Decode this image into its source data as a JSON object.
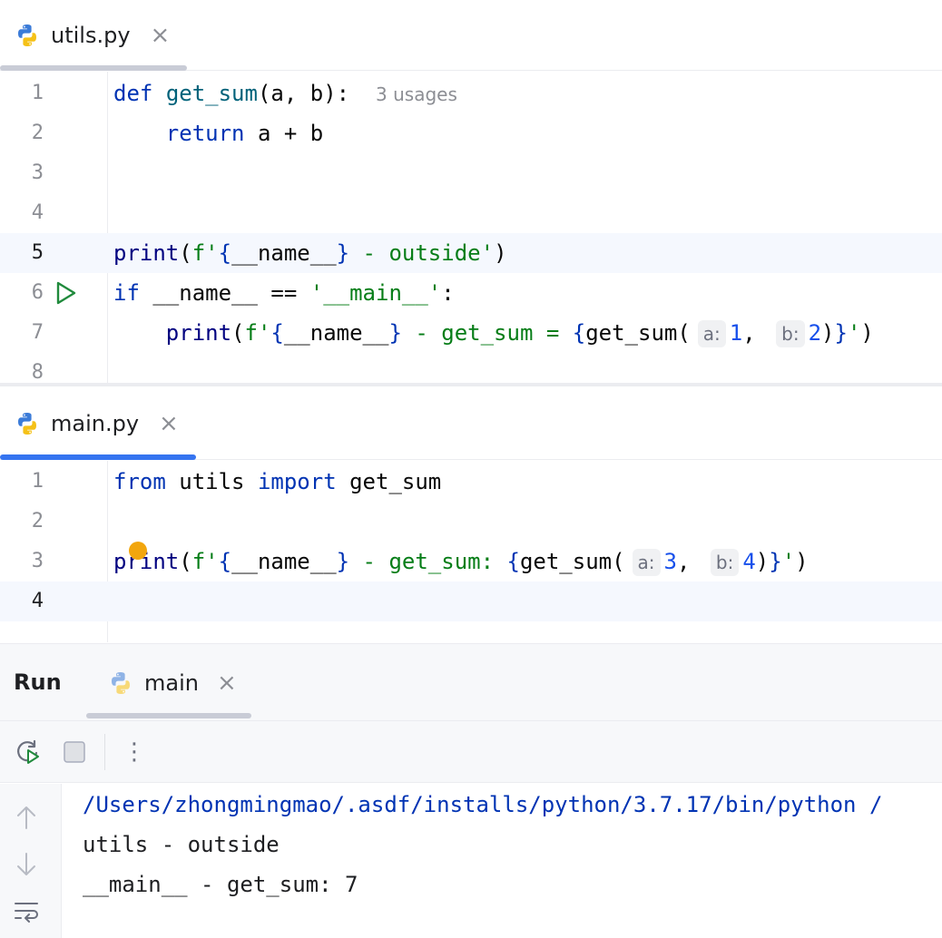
{
  "editors": [
    {
      "tab": {
        "filename": "utils.py",
        "close": "×"
      },
      "usages_hint": "3 usages",
      "lines": [
        "1",
        "2",
        "3",
        "4",
        "5",
        "6",
        "7",
        "8"
      ]
    },
    {
      "tab": {
        "filename": "main.py",
        "close": "×"
      },
      "lines": [
        "1",
        "2",
        "3",
        "4"
      ]
    }
  ],
  "code": {
    "u1": {
      "kw": "def",
      "fn": "get_sum",
      "rest": "(a, b):"
    },
    "u2": {
      "kw": "return",
      "rest": " a + b"
    },
    "u5": {
      "print": "print",
      "p1": "(",
      "f": "f'",
      "b1": "{",
      "nm": "__name__",
      "b2": "}",
      "s": " - outside",
      "q": "'",
      "p2": ")"
    },
    "u6": {
      "kw": "if",
      "rest": " __name__ == ",
      "s": "'__main__'",
      "colon": ":"
    },
    "u7": {
      "print": "print",
      "p1": "(",
      "f": "f'",
      "b1": "{",
      "nm": "__name__",
      "b2": "}",
      "s": " - get_sum = ",
      "b3": "{",
      "call": "get_sum(",
      "ha": "a:",
      "va": "1",
      "comma": ",",
      "hb": "b:",
      "vb": "2",
      "close": ")",
      "b4": "}",
      "q": "'",
      "p2": ")"
    },
    "m1": {
      "kw1": "from",
      "mod": " utils ",
      "kw2": "import",
      "name": " get_sum"
    },
    "m3": {
      "print": "print",
      "p1": "(",
      "f": "f'",
      "b1": "{",
      "nm": "__name__",
      "b2": "}",
      "s": " - get_sum: ",
      "b3": "{",
      "call": "get_sum(",
      "ha": "a:",
      "va": "3",
      "comma": ",",
      "hb": "b:",
      "vb": "4",
      "close": ")",
      "b4": "}",
      "q": "'",
      "p2": ")"
    }
  },
  "run": {
    "title": "Run",
    "tab_label": "main",
    "close": "×",
    "more": "⋮",
    "output": [
      "/Users/zhongmingmao/.asdf/installs/python/3.7.17/bin/python /",
      "utils - outside",
      "__main__ - get_sum: 7"
    ]
  },
  "colors": {
    "accent": "#3574f0",
    "keyword": "#0033b3",
    "string": "#067d17",
    "number": "#1750eb",
    "run_green": "#208a3c",
    "bulb": "#f2a60d"
  }
}
